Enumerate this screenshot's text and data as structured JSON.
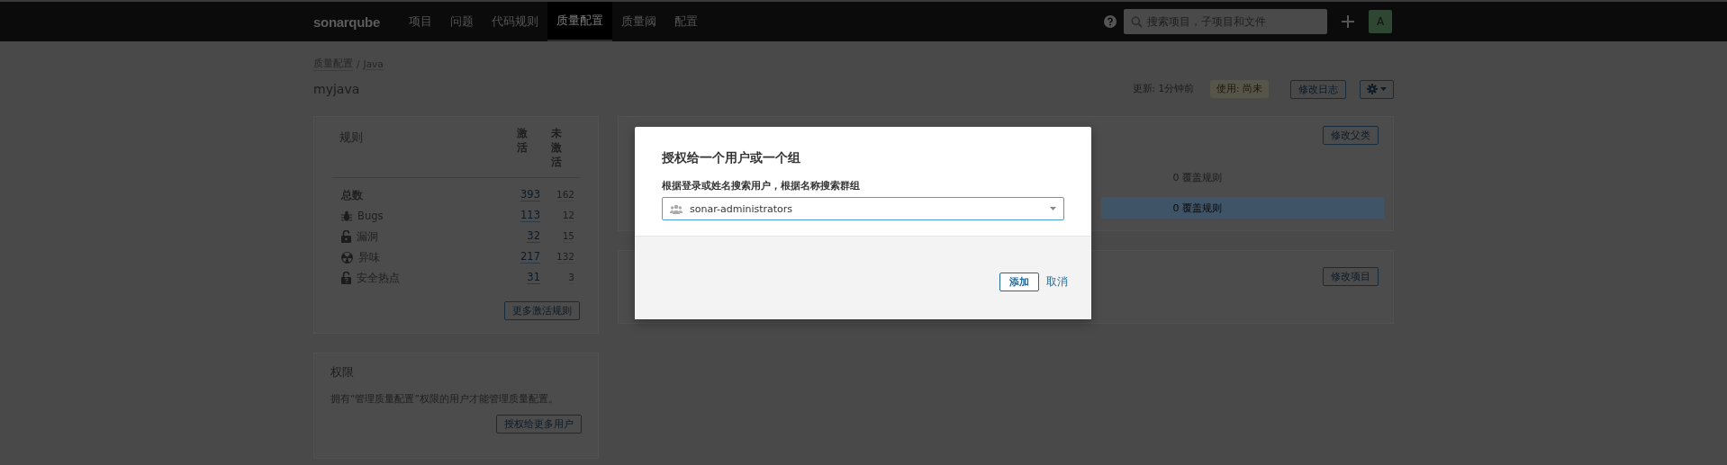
{
  "navbar": {
    "logo": "sonarqube",
    "items": [
      {
        "label": "项目",
        "selected": false
      },
      {
        "label": "问题",
        "selected": false
      },
      {
        "label": "代码规则",
        "selected": false
      },
      {
        "label": "质量配置",
        "selected": true
      },
      {
        "label": "质量阈",
        "selected": false
      },
      {
        "label": "配置",
        "selected": false
      }
    ],
    "search": {
      "placeholder": "搜索项目，子项目和文件"
    },
    "avatar": "A"
  },
  "breadcrumb": {
    "items": [
      "质量配置",
      "Java"
    ],
    "separator": "/"
  },
  "profile": {
    "name": "myjava",
    "updated": "更新: 1分钟前",
    "usage": "使用: 尚未",
    "changelog_button": "修改日志"
  },
  "rules": {
    "title": "规则",
    "columns": [
      "激活",
      "未激活"
    ],
    "rows": [
      {
        "kind": "total",
        "label": "总数",
        "active": "393",
        "inactive": "162"
      },
      {
        "kind": "bug",
        "label": "Bugs",
        "active": "113",
        "inactive": "12"
      },
      {
        "kind": "vulnerability",
        "label": "漏洞",
        "active": "32",
        "inactive": "15"
      },
      {
        "kind": "code_smell",
        "label": "异味",
        "active": "217",
        "inactive": "132"
      },
      {
        "kind": "hotspot",
        "label": "安全热点",
        "active": "31",
        "inactive": "3"
      }
    ],
    "button": "更多激活规则"
  },
  "permissions": {
    "title": "权限",
    "text": "拥有“管理质量配置”权限的用户才能管理质量配置。",
    "button": "授权给更多用户"
  },
  "inheritance": {
    "button": "修改父类",
    "rows": [
      {
        "reading": "0 覆盖规则",
        "selected": false
      },
      {
        "reading": "0 覆盖规则",
        "selected": true
      }
    ]
  },
  "projects": {
    "button": "修改项目"
  },
  "dialog": {
    "title": "授权给一个用户或一个组",
    "label": "根据登录或姓名搜索用户，根据名称搜索群组",
    "select": {
      "value": "sonar-administrators"
    },
    "buttons": [
      {
        "kind": "primary",
        "label": "添加"
      },
      {
        "kind": "link",
        "label": "取消"
      }
    ]
  }
}
